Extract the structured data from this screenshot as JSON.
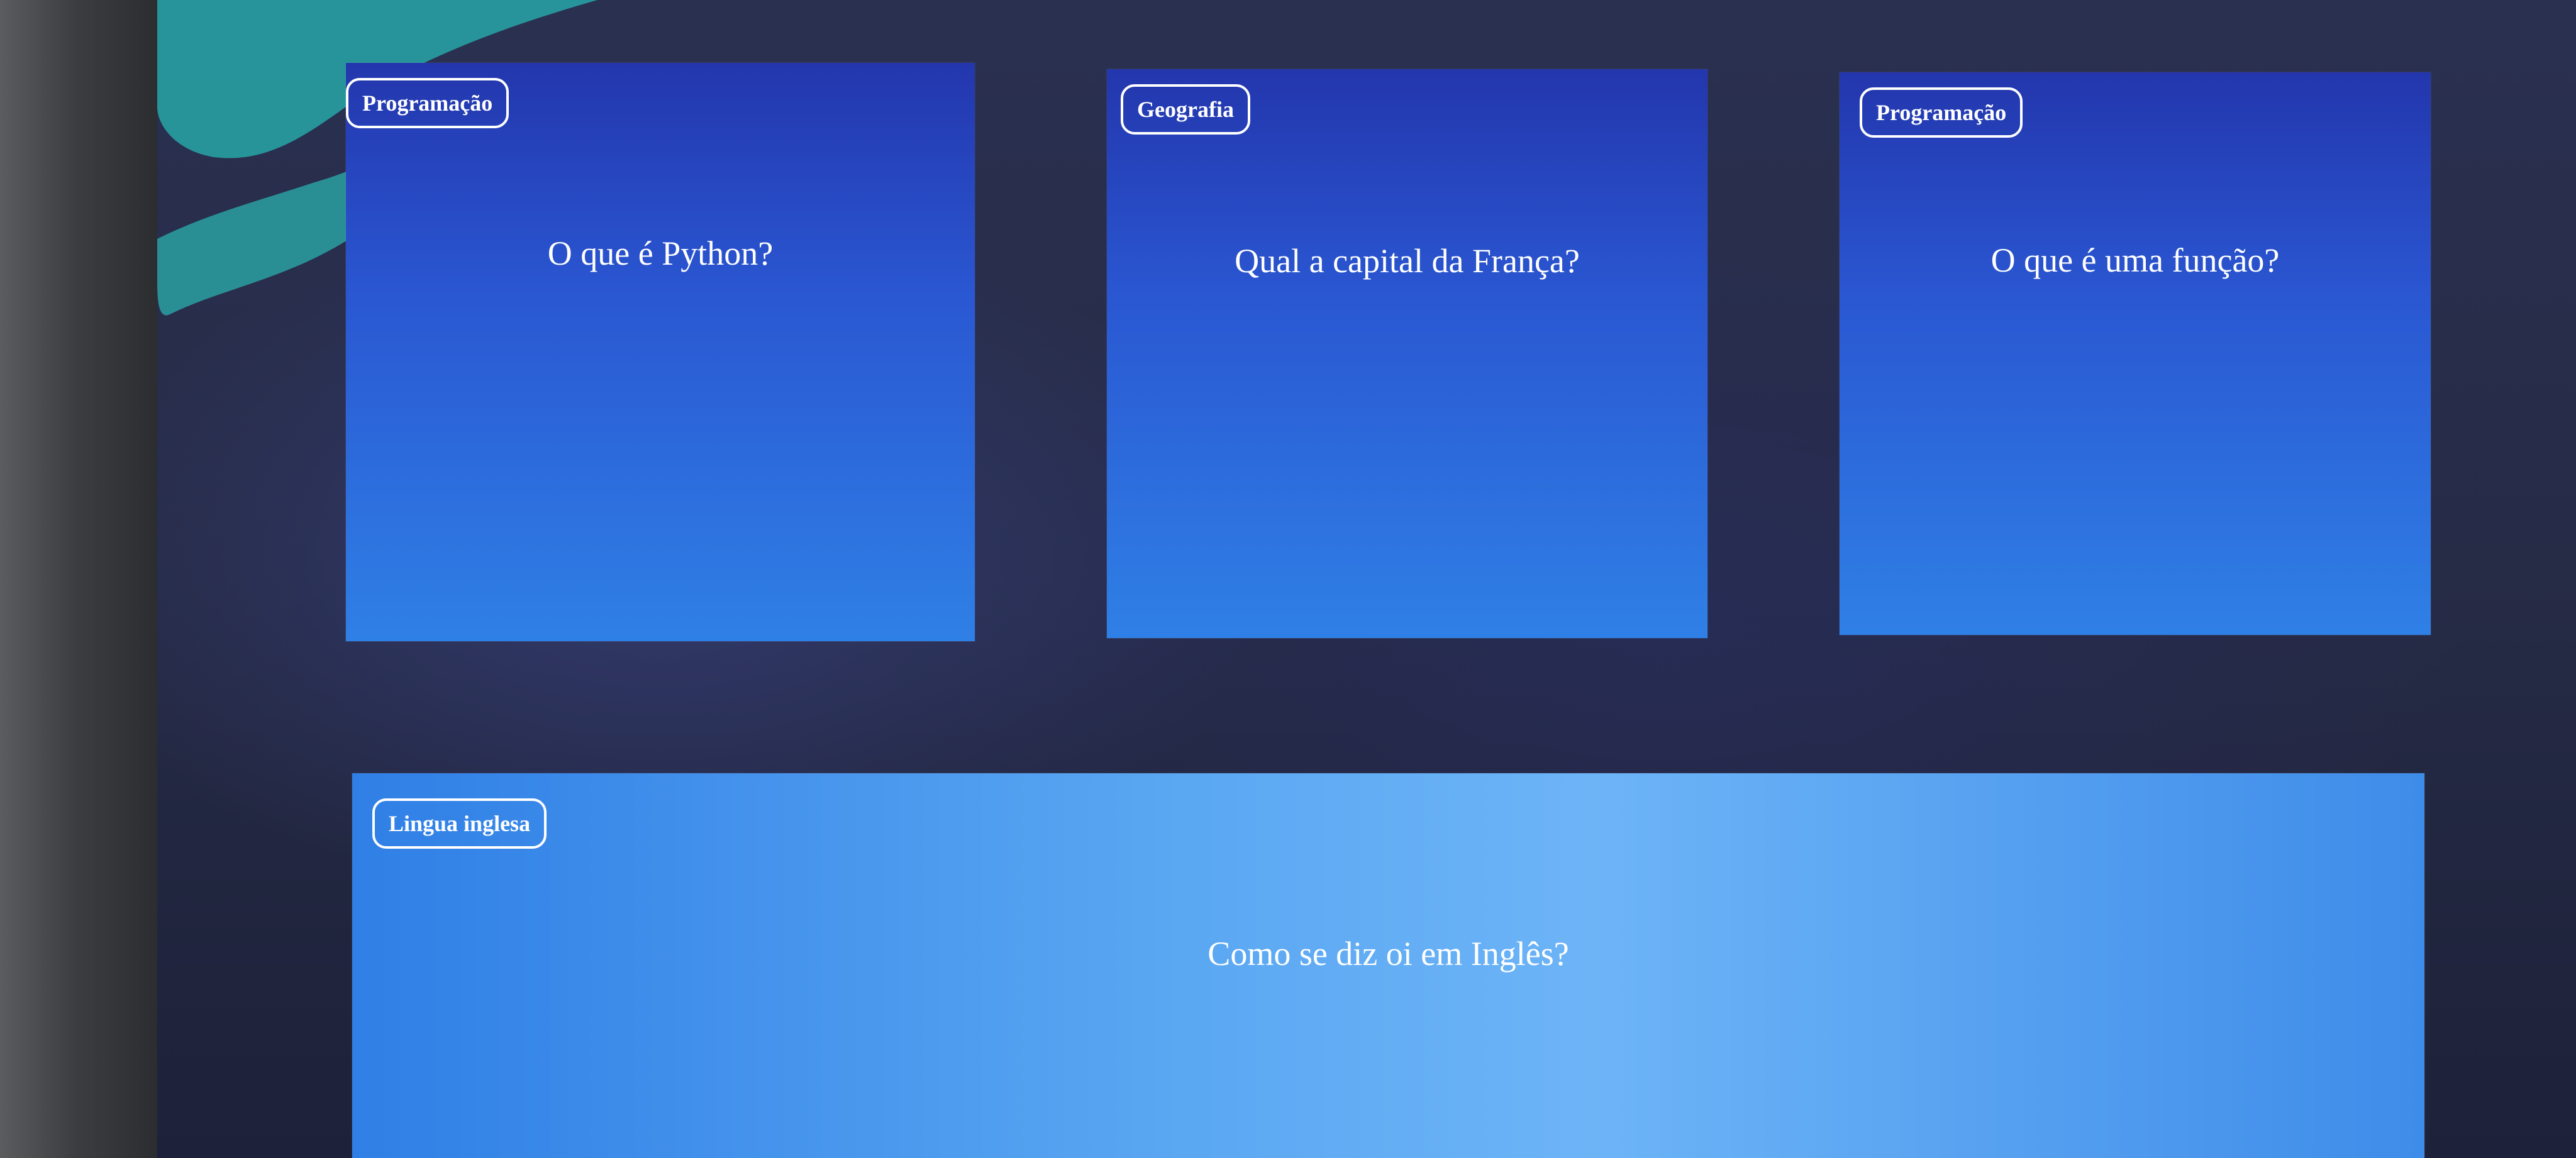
{
  "cards": [
    {
      "category": "Programação",
      "question": "O que é Python?"
    },
    {
      "category": "Geografia",
      "question": "Qual a capital da França?"
    },
    {
      "category": "Programação",
      "question": "O que é uma função?"
    },
    {
      "category": "Lingua inglesa",
      "question": "Como se diz oi em Inglês?"
    }
  ]
}
